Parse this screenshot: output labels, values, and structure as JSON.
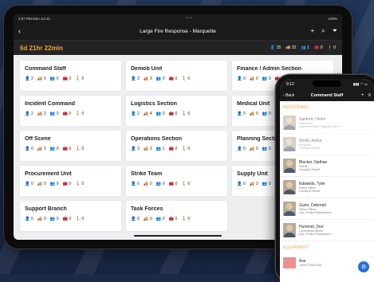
{
  "tablet": {
    "status_time": "2:07 PM   Mon Jul 21",
    "status_right": "100%",
    "nav_title": "Large Fire Response - Marquette",
    "timer": "6d 21hr 22min",
    "totals": {
      "people": "15",
      "vehicles": "22",
      "teams": "1",
      "equipment": "0",
      "other": "0"
    },
    "cards": [
      {
        "title": "Command Staff",
        "c": [
          "2",
          "0",
          "0",
          "0",
          "0"
        ]
      },
      {
        "title": "Demob Unit",
        "c": [
          "3",
          "3",
          "0",
          "0",
          "0"
        ]
      },
      {
        "title": "Finance / Admin Section",
        "c": [
          "0",
          "0",
          "0",
          "0",
          "0"
        ]
      },
      {
        "title": "Incident Command",
        "c": [
          "2",
          "2",
          "0",
          "0",
          "0"
        ]
      },
      {
        "title": "Logistics Section",
        "c": [
          "2",
          "4",
          "0",
          "0",
          "0"
        ]
      },
      {
        "title": "Medical Unit",
        "c": [
          "0",
          "0",
          "0",
          "0",
          "0"
        ]
      },
      {
        "title": "Off Scene",
        "c": [
          "0",
          "0",
          "0",
          "0",
          "0"
        ]
      },
      {
        "title": "Operations Section",
        "c": [
          "3",
          "2",
          "1",
          "0",
          "0"
        ]
      },
      {
        "title": "Planning Section",
        "c": [
          "0",
          "0",
          "0",
          "0",
          "0"
        ]
      },
      {
        "title": "Procurement Unit",
        "c": [
          "0",
          "0",
          "0",
          "0",
          "0"
        ]
      },
      {
        "title": "Strike Team",
        "c": [
          "0",
          "0",
          "0",
          "0",
          "0"
        ]
      },
      {
        "title": "Supply Unit",
        "c": [
          "0",
          "3",
          "0",
          "0",
          "0"
        ]
      },
      {
        "title": "Support Branch",
        "c": [
          "0",
          "0",
          "0",
          "0",
          "0"
        ]
      },
      {
        "title": "Task Forces",
        "c": [
          "0",
          "0",
          "0",
          "0",
          "0"
        ]
      }
    ]
  },
  "phone": {
    "time": "9:12",
    "back": "Back",
    "title": "Command Staff",
    "personnel_header": "PERSONNEL",
    "people": [
      {
        "name": "Sanford, Helen",
        "role": "Dispatcher",
        "org": "Anywhere State Highway Patrol",
        "faded": true
      },
      {
        "name": "Smith, Arthur",
        "role": "Sergeant",
        "org": "County A Sheriff",
        "faded": true
      },
      {
        "name": "Blocker, Nathan",
        "role": "Sheriff",
        "org": "County A Sheriff",
        "faded": false
      },
      {
        "name": "Edwards, Tyler",
        "role": "Police Officer",
        "org": "County A Sheriff",
        "faded": false
      },
      {
        "name": "Gunn, Deborah",
        "role": "Police Officer",
        "org": "City 1 Police Department",
        "faded": false
      },
      {
        "name": "Hummel, Don",
        "role": "Corrections Officer",
        "org": "City 1 Police Department",
        "faded": false
      }
    ],
    "equipment_header": "EQUIPMENT",
    "equipment": {
      "name": "Axe",
      "id": "240917T0922743"
    }
  },
  "icons": {
    "people": "person-icon",
    "vehicles": "truck-icon",
    "teams": "group-icon",
    "equipment": "toolbox-icon",
    "other": "figure-icon"
  }
}
